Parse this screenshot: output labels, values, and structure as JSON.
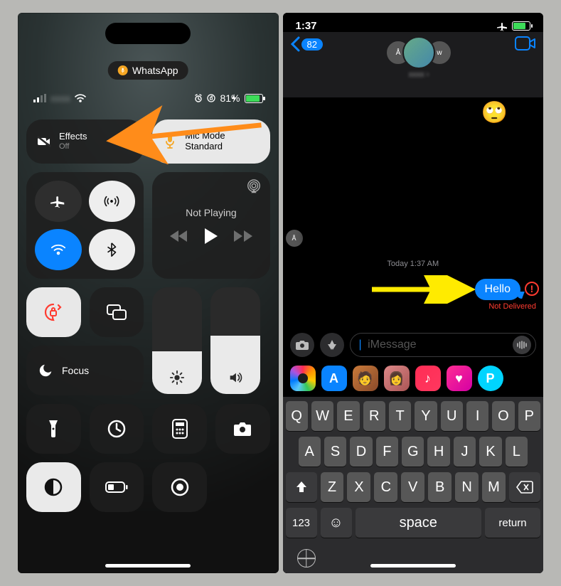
{
  "left": {
    "pill_app": "WhatsApp",
    "battery_pct": "81%",
    "effects_label": "Effects",
    "effects_state": "Off",
    "micmode_label": "Mic Mode",
    "micmode_state": "Standard",
    "media_title": "Not Playing",
    "focus_label": "Focus",
    "brightness_pct": 40,
    "volume_pct": 55
  },
  "right": {
    "time": "1:37",
    "back_badge": "82",
    "timestamp": "Today 1:37 AM",
    "msg_text": "Hello",
    "delivery_status": "Not Delivered",
    "compose_placeholder": " iMessage",
    "keys_row1": [
      "Q",
      "W",
      "E",
      "R",
      "T",
      "Y",
      "U",
      "I",
      "O",
      "P"
    ],
    "keys_row2": [
      "A",
      "S",
      "D",
      "F",
      "G",
      "H",
      "J",
      "K",
      "L"
    ],
    "keys_row3": [
      "Z",
      "X",
      "C",
      "V",
      "B",
      "N",
      "M"
    ],
    "key_123": "123",
    "key_space": "space",
    "key_return": "return"
  }
}
